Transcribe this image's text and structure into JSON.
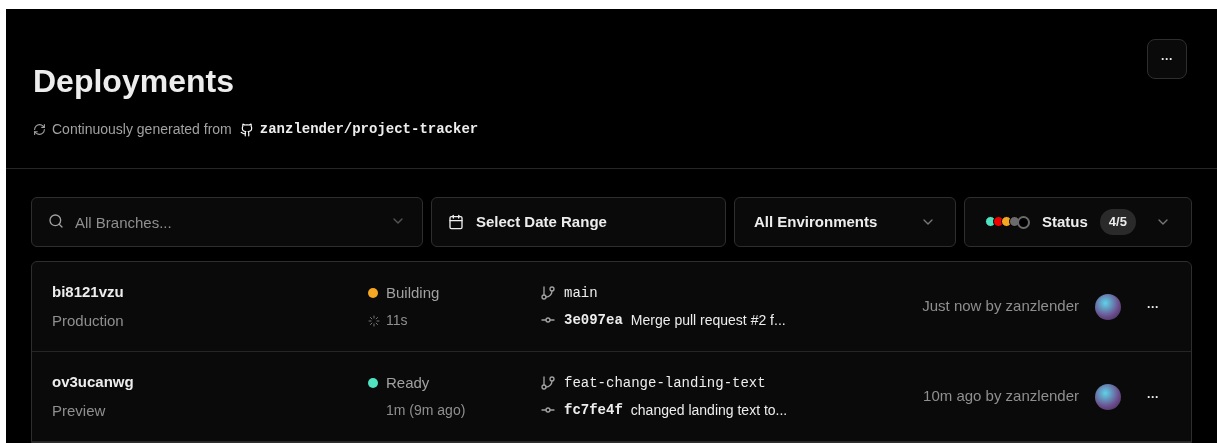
{
  "header": {
    "title": "Deployments",
    "subtitle": "Continuously generated from",
    "repo": "zanzlender/project-tracker",
    "more": "···"
  },
  "filters": {
    "branches": {
      "placeholder": "All Branches..."
    },
    "date": {
      "label": "Select Date Range"
    },
    "environments": {
      "label": "All Environments"
    },
    "status": {
      "label": "Status",
      "count": "4/5",
      "dots": [
        {
          "color": "#50e3c2",
          "selected": true
        },
        {
          "color": "#ee0000",
          "selected": true
        },
        {
          "color": "#f5a623",
          "selected": true
        },
        {
          "color": "#6b6b6b",
          "selected": true
        },
        {
          "color": "#6b6b6b",
          "selected": false
        }
      ]
    }
  },
  "deployments": [
    {
      "id": "bi8121vzu",
      "environment": "Production",
      "status": "Building",
      "color": "#f5a623",
      "kind": "building",
      "duration": "11s",
      "branch": "main",
      "commit": "3e097ea",
      "message": "Merge pull request #2 f...",
      "time": "Just now by zanzlender",
      "more": "···"
    },
    {
      "id": "ov3ucanwg",
      "environment": "Preview",
      "status": "Ready",
      "color": "#50e3c2",
      "kind": "ready",
      "duration": "1m (9m ago)",
      "branch": "feat-change-landing-text",
      "commit": "fc7fe4f",
      "message": "changed landing text to...",
      "time": "10m ago by zanzlender",
      "more": "···"
    }
  ]
}
